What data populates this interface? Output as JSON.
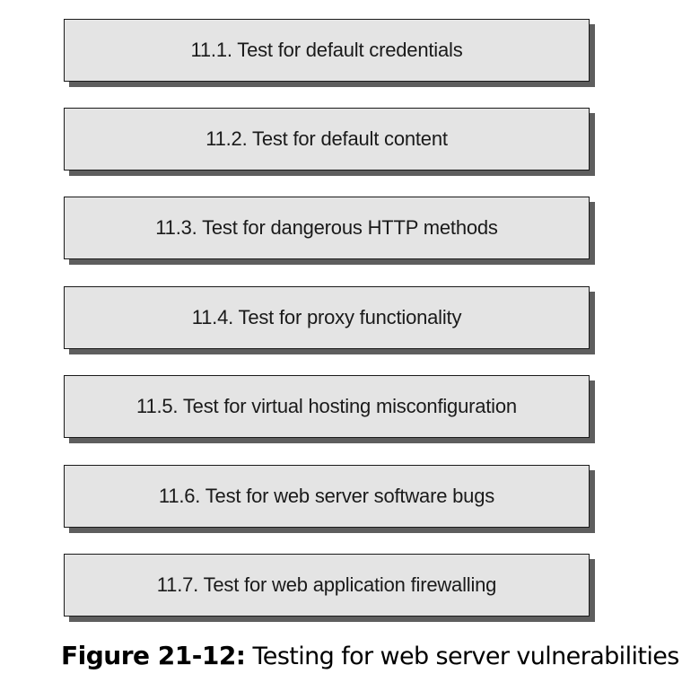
{
  "steps": [
    {
      "label": "11.1. Test for default credentials"
    },
    {
      "label": "11.2. Test for default content"
    },
    {
      "label": "11.3. Test for dangerous HTTP methods"
    },
    {
      "label": "11.4. Test for proxy functionality"
    },
    {
      "label": "11.5. Test for virtual hosting misconfiguration"
    },
    {
      "label": "11.6. Test for web server software bugs"
    },
    {
      "label": "11.7. Test for web application firewalling"
    }
  ],
  "caption": {
    "number": "Figure 21-12:",
    "text": "Testing for web server vulnerabilities"
  }
}
